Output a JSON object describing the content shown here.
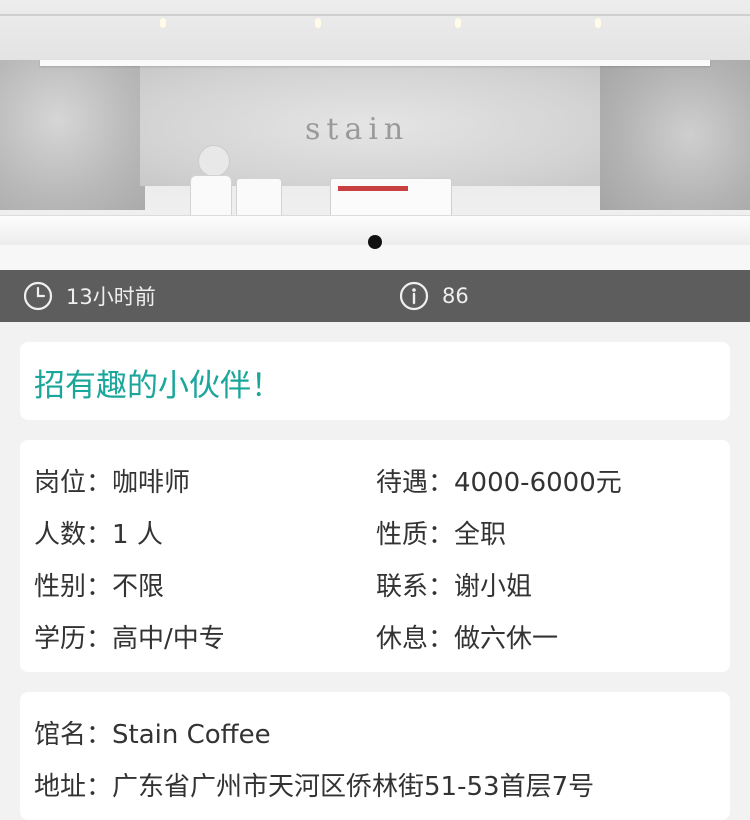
{
  "hero": {
    "sign_text": "stain"
  },
  "meta": {
    "time_ago": "13小时前",
    "views": "86"
  },
  "title": "招有趣的小伙伴！",
  "details": {
    "left": [
      {
        "label": "岗位：",
        "value": "咖啡师"
      },
      {
        "label": "人数：",
        "value": "1 人"
      },
      {
        "label": "性别：",
        "value": "不限"
      },
      {
        "label": "学历：",
        "value": "高中/中专"
      }
    ],
    "right": [
      {
        "label": "待遇：",
        "value": "4000-6000元"
      },
      {
        "label": "性质：",
        "value": "全职"
      },
      {
        "label": "联系：",
        "value": "谢小姐"
      },
      {
        "label": "休息：",
        "value": "做六休一"
      }
    ]
  },
  "shop": {
    "name_label": "馆名：",
    "name": "Stain Coffee",
    "address_label": "地址：",
    "address": "广东省广州市天河区侨林街51-53首层7号"
  },
  "colors": {
    "title": "#1aa69a",
    "metabar": "#5d5d5d",
    "background": "#f2f2f2"
  }
}
